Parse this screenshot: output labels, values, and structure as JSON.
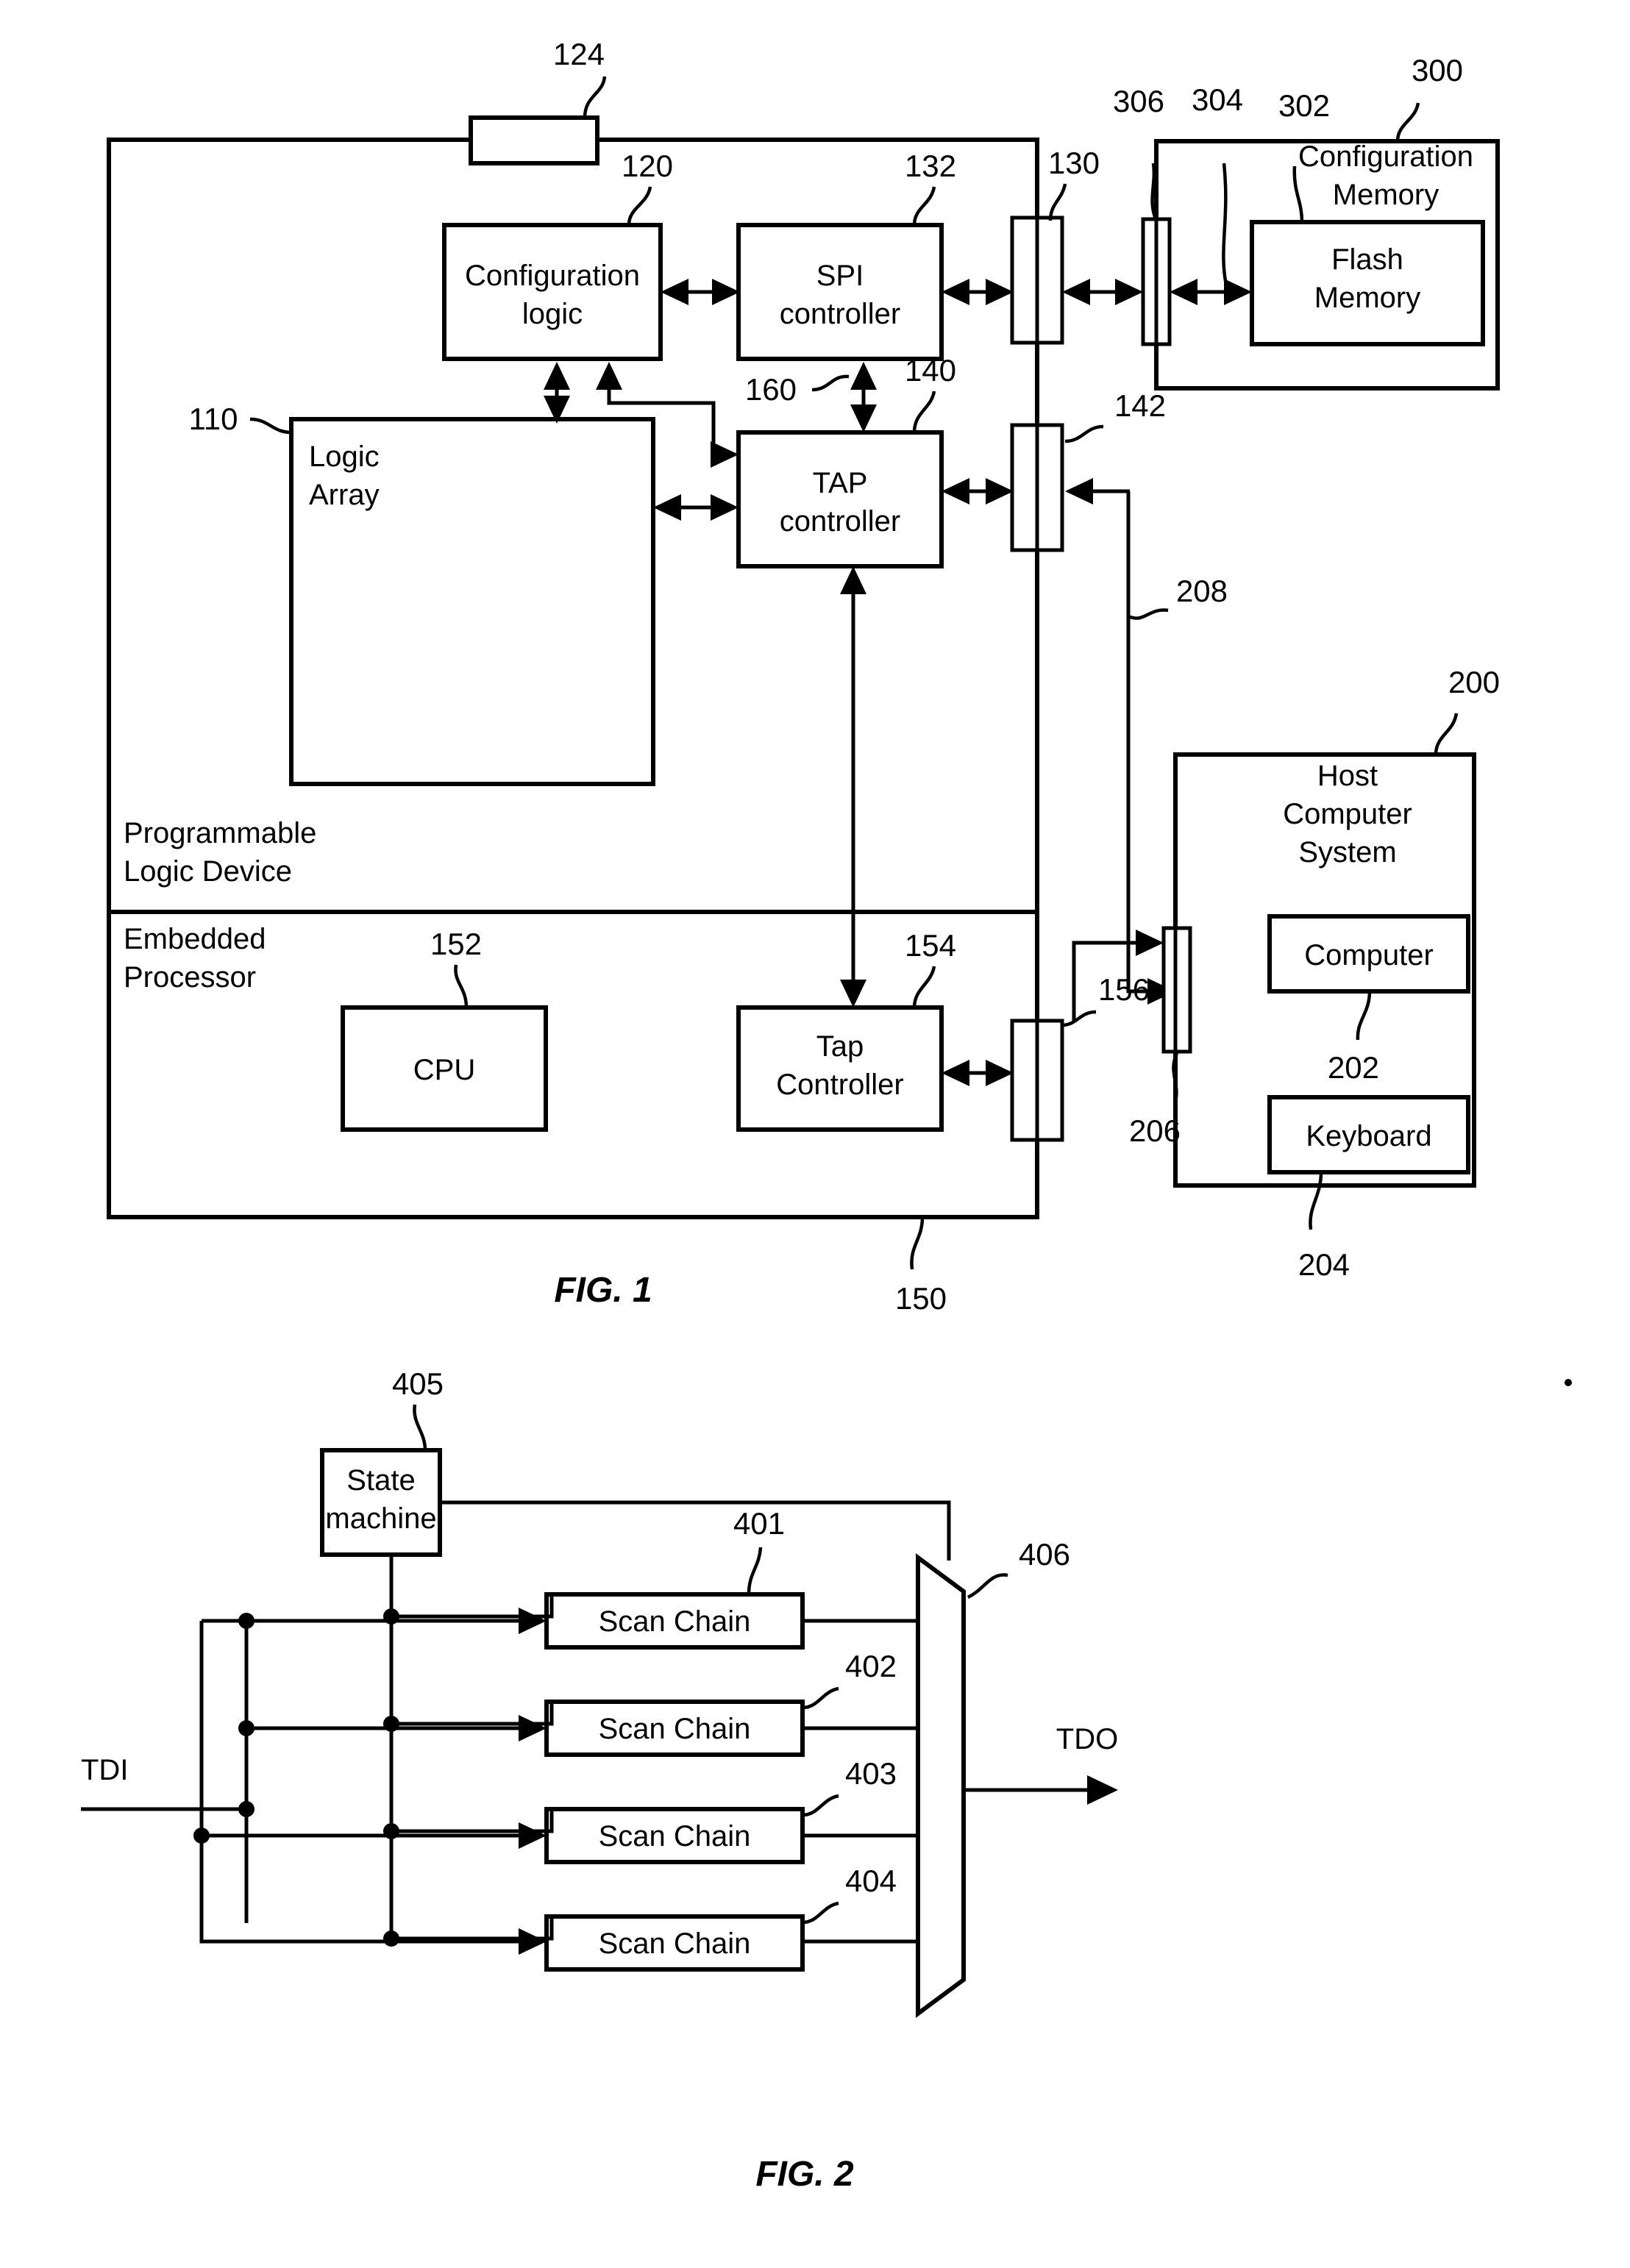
{
  "document": {
    "kind": "patent-drawing-sheet",
    "figures": [
      {
        "caption": "FIG. 1"
      },
      {
        "caption": "FIG. 2"
      }
    ]
  },
  "fig1": {
    "caption": "FIG. 1",
    "blocks": {
      "configuration_logic": "Configuration\nlogic",
      "configuration_logic_line1": "Configuration",
      "configuration_logic_line2": "logic",
      "spi_controller_line1": "SPI",
      "spi_controller_line2": "controller",
      "logic_array_line1": "Logic",
      "logic_array_line2": "Array",
      "tap_controller_line1": "TAP",
      "tap_controller_line2": "controller",
      "cpu": "CPU",
      "tap_controller2_line1": "Tap",
      "tap_controller2_line2": "Controller",
      "flash_memory_line1": "Flash",
      "flash_memory_line2": "Memory",
      "computer": "Computer",
      "keyboard": "Keyboard"
    },
    "region_labels": {
      "pld_line1": "Programmable",
      "pld_line2": "Logic Device",
      "embedded_line1": "Embedded",
      "embedded_line2": "Processor",
      "config_memory_line1": "Configuration",
      "config_memory_line2": "Memory",
      "host_line1": "Host",
      "host_line2": "Computer",
      "host_line3": "System"
    },
    "reference_numerals": {
      "n110": "110",
      "n120": "120",
      "n124": "124",
      "n130": "130",
      "n132": "132",
      "n140": "140",
      "n142": "142",
      "n150": "150",
      "n152": "152",
      "n154": "154",
      "n156": "156",
      "n160": "160",
      "n200": "200",
      "n202": "202",
      "n204": "204",
      "n206": "206",
      "n208": "208",
      "n300": "300",
      "n302": "302",
      "n304": "304",
      "n306": "306"
    }
  },
  "fig2": {
    "caption": "FIG. 2",
    "blocks": {
      "state_machine_line1": "State",
      "state_machine_line2": "machine",
      "scan_chain_1": "Scan Chain",
      "scan_chain_2": "Scan Chain",
      "scan_chain_3": "Scan Chain",
      "scan_chain_4": "Scan Chain"
    },
    "signals": {
      "tdi": "TDI",
      "tdo": "TDO"
    },
    "reference_numerals": {
      "n401": "401",
      "n402": "402",
      "n403": "403",
      "n404": "404",
      "n405": "405",
      "n406": "406"
    }
  },
  "colors": {
    "ink": "#000000",
    "paper": "#ffffff"
  }
}
